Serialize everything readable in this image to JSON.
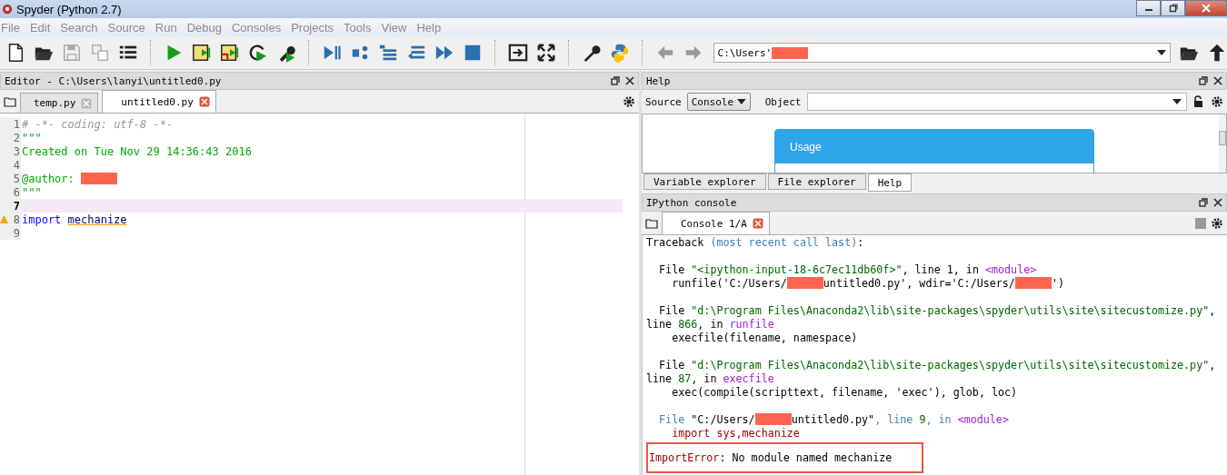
{
  "window": {
    "title": "Spyder (Python 2.7)"
  },
  "menu": [
    "File",
    "Edit",
    "Search",
    "Source",
    "Run",
    "Debug",
    "Consoles",
    "Projects",
    "Tools",
    "View",
    "Help"
  ],
  "path_field": {
    "segments": [
      {
        "kind": "plain",
        "text": "C:\\Users'"
      },
      {
        "kind": "redacted"
      }
    ]
  },
  "editor": {
    "title": "Editor - C:\\Users\\lanyi\\untitled0.py",
    "tabs": [
      {
        "label": "temp.py",
        "selected": false
      },
      {
        "label": "untitled0.py",
        "selected": true
      }
    ],
    "lines": [
      {
        "number": "1",
        "current": false,
        "warning": false,
        "segments": [
          {
            "kind": "comment",
            "text": "# -*- coding: utf-8 -*-"
          }
        ]
      },
      {
        "number": "2",
        "current": false,
        "warning": false,
        "segments": [
          {
            "kind": "string",
            "text": "\"\"\""
          }
        ]
      },
      {
        "number": "3",
        "current": false,
        "warning": false,
        "segments": [
          {
            "kind": "string",
            "text": "Created on Tue Nov 29 14:36:43 2016"
          }
        ]
      },
      {
        "number": "4",
        "current": false,
        "warning": false
      },
      {
        "number": "5",
        "current": false,
        "warning": false,
        "segments": [
          {
            "kind": "string",
            "text": "@author: "
          },
          {
            "kind": "redacted"
          }
        ]
      },
      {
        "number": "6",
        "current": false,
        "warning": false,
        "segments": [
          {
            "kind": "string",
            "text": "\"\"\""
          }
        ]
      },
      {
        "number": "7",
        "current": true,
        "warning": false
      },
      {
        "number": "8",
        "current": false,
        "warning": true,
        "segments": [
          {
            "kind": "keyword",
            "text": "import"
          },
          {
            "kind": "flagged",
            "text": "mechanize"
          }
        ]
      },
      {
        "number": "9",
        "current": false,
        "warning": false
      }
    ]
  },
  "help": {
    "title": "Help",
    "source_label": "Source",
    "source_value": "Console",
    "object_label": "Object",
    "usage_title": "Usage",
    "tabs": [
      {
        "label": "Variable explorer",
        "selected": false
      },
      {
        "label": "File explorer",
        "selected": false
      },
      {
        "label": "Help",
        "selected": true
      }
    ]
  },
  "console": {
    "title": "IPython console",
    "tabs": [
      {
        "label": "Console 1/A",
        "selected": true
      }
    ],
    "blocks": [
      {
        "lines": [
          {
            "segments": [
              {
                "kind": "plain",
                "text": "Traceback "
              },
              {
                "kind": "blue",
                "text": "(most recent call last)"
              },
              {
                "kind": "plain",
                "text": ":"
              }
            ]
          }
        ]
      },
      {
        "lines": [
          {
            "segments": [
              {
                "kind": "plain",
                "text": "  File "
              },
              {
                "kind": "green",
                "text": "\"<ipython-input-18-6c7ec11db60f>\""
              },
              {
                "kind": "plain",
                "text": ", line 1, in "
              },
              {
                "kind": "purple",
                "text": "<module>"
              }
            ]
          },
          {
            "segments": [
              {
                "kind": "plain",
                "text": "    runfile('C:/Users/"
              },
              {
                "kind": "redacted"
              },
              {
                "kind": "plain",
                "text": "untitled0.py', wdir='C:/Users/"
              },
              {
                "kind": "redacted"
              },
              {
                "kind": "plain",
                "text": "')"
              }
            ]
          }
        ]
      },
      {
        "lines": [
          {
            "segments": [
              {
                "kind": "plain",
                "text": "  File "
              },
              {
                "kind": "green",
                "text": "\"d:\\Program Files\\Anaconda2\\lib\\site-packages\\spyder\\utils\\site\\sitecustomize.py\""
              },
              {
                "kind": "plain",
                "text": ","
              }
            ]
          },
          {
            "segments": [
              {
                "kind": "plain",
                "text": "line "
              },
              {
                "kind": "green",
                "text": "866"
              },
              {
                "kind": "plain",
                "text": ", in "
              },
              {
                "kind": "purple",
                "text": "runfile"
              }
            ]
          },
          {
            "segments": [
              {
                "kind": "plain",
                "text": "    execfile(filename, namespace)"
              }
            ]
          }
        ]
      },
      {
        "lines": [
          {
            "segments": [
              {
                "kind": "plain",
                "text": "  File "
              },
              {
                "kind": "green",
                "text": "\"d:\\Program Files\\Anaconda2\\lib\\site-packages\\spyder\\utils\\site\\sitecustomize.py\""
              },
              {
                "kind": "plain",
                "text": ","
              }
            ]
          },
          {
            "segments": [
              {
                "kind": "plain",
                "text": "line "
              },
              {
                "kind": "green",
                "text": "87"
              },
              {
                "kind": "plain",
                "text": ", in "
              },
              {
                "kind": "purple",
                "text": "execfile"
              }
            ]
          },
          {
            "segments": [
              {
                "kind": "plain",
                "text": "    exec(compile(scripttext, filename, 'exec'), glob, loc)"
              }
            ]
          }
        ]
      },
      {
        "lines": [
          {
            "segments": [
              {
                "kind": "blue",
                "text": "  File "
              },
              {
                "kind": "plain",
                "text": "\"C:/Users/"
              },
              {
                "kind": "redacted"
              },
              {
                "kind": "plain",
                "text": "untitled0.py\""
              },
              {
                "kind": "blue",
                "text": ", line "
              },
              {
                "kind": "green",
                "text": "9"
              },
              {
                "kind": "blue",
                "text": ", in "
              },
              {
                "kind": "purple",
                "text": "<module>"
              }
            ]
          },
          {
            "segments": [
              {
                "kind": "darkred",
                "text": "    import sys,mechanize"
              }
            ]
          }
        ]
      }
    ],
    "error": {
      "segments": [
        {
          "kind": "darkred",
          "text": "ImportError"
        },
        {
          "kind": "plain",
          "text": ": No module named mechanize"
        }
      ]
    }
  }
}
